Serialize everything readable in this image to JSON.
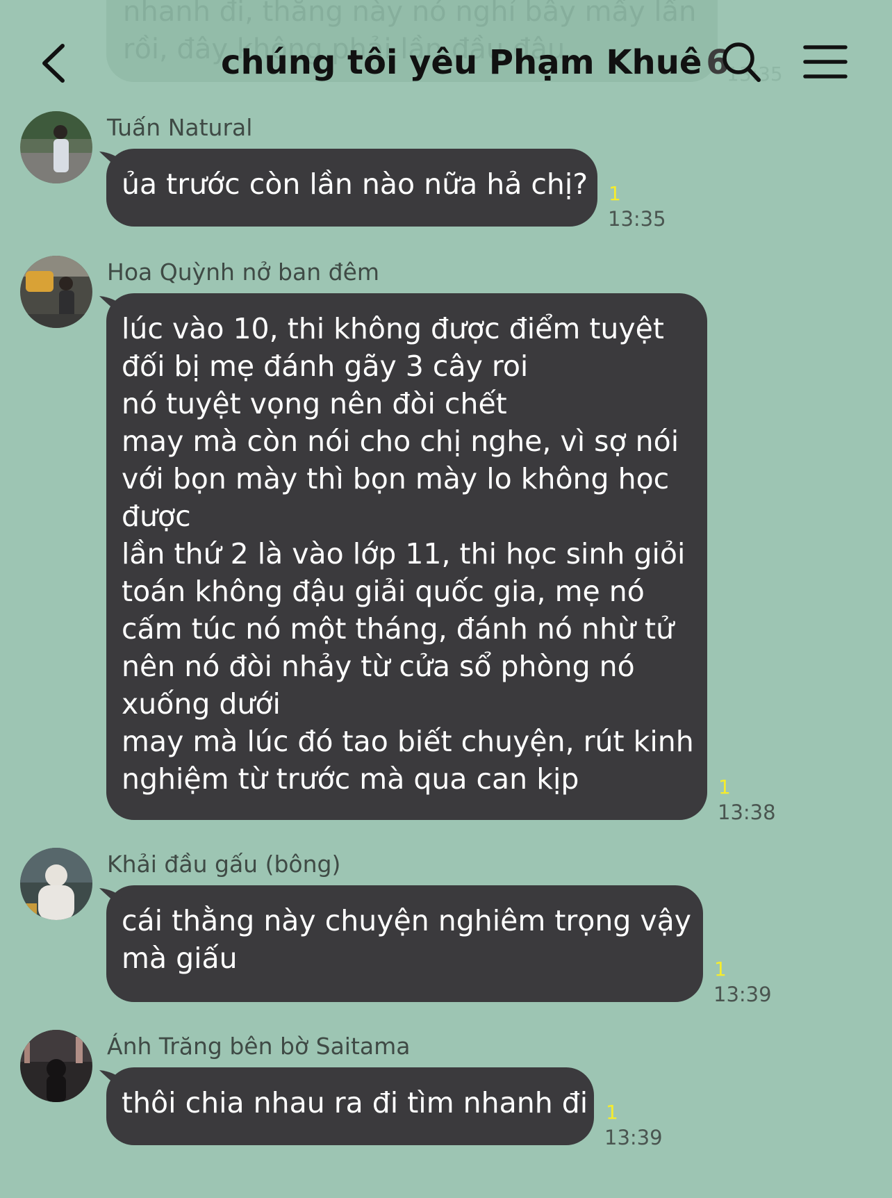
{
  "colors": {
    "background": "#9dc5b3",
    "bubble": "#3b3a3d",
    "bubble_text": "#ffffff",
    "read_count": "#f5ec2c"
  },
  "partial_message": {
    "lines": [
      "nhanh đi, thằng này nó nghỉ bây mấy lần",
      "rồi, đây không phải lần đầu đâu"
    ],
    "time": "13:35"
  },
  "header": {
    "back_icon": "chevron-left-icon",
    "title": "chúng tôi yêu Phạm Khuê",
    "member_count": "6",
    "search_icon": "search-icon",
    "menu_icon": "hamburger-menu-icon"
  },
  "messages": [
    {
      "sender": "Tuấn Natural",
      "lines": [
        "ủa trước còn lần nào nữa hả chị?"
      ],
      "read": "1",
      "time": "13:35"
    },
    {
      "sender": "Hoa Quỳnh nở ban đêm",
      "lines": [
        "lúc vào 10, thi không được điểm tuyệt",
        "đối bị mẹ đánh gãy 3 cây roi",
        "nó tuyệt vọng nên đòi chết",
        "may mà còn nói cho chị nghe, vì sợ nói",
        "với bọn mày thì bọn mày lo không học",
        "được",
        "lần thứ 2 là vào lớp 11, thi học sinh giỏi",
        "toán không đậu giải quốc gia, mẹ nó",
        "cấm túc nó một tháng, đánh nó nhừ tử",
        "nên nó đòi nhảy từ cửa sổ phòng nó",
        "xuống dưới",
        "may mà lúc đó tao biết chuyện, rút kinh",
        "nghiệm từ trước mà qua can kịp"
      ],
      "read": "1",
      "time": "13:38"
    },
    {
      "sender": "Khải đầu gấu (bông)",
      "lines": [
        "cái thằng này chuyện nghiêm trọng vậy",
        "mà giấu"
      ],
      "read": "1",
      "time": "13:39"
    },
    {
      "sender": "Ánh Trăng bên bờ Saitama",
      "lines": [
        "thôi chia nhau ra đi tìm nhanh đi"
      ],
      "read": "1",
      "time": "13:39"
    }
  ]
}
